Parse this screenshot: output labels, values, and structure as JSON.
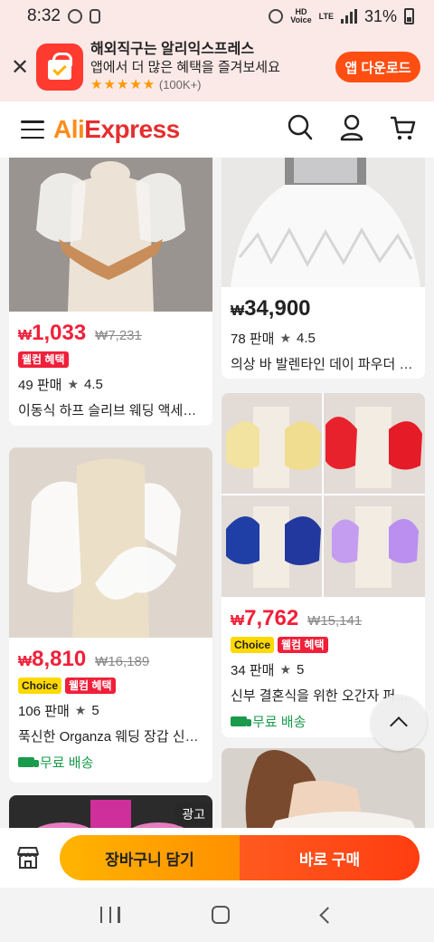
{
  "status_bar": {
    "time": "8:32",
    "network": "LTE",
    "battery": "31%"
  },
  "app_banner": {
    "title": "해외직구는 알리익스프레스",
    "subtitle": "앱에서 더 많은 혜택을 즐겨보세요",
    "stars": "★★★★★",
    "rating_count": "(100K+)",
    "download_label": "앱 다운로드"
  },
  "header": {
    "logo_prefix": "Ali",
    "logo_suffix": "Express"
  },
  "products": [
    {
      "price_symbol": "₩",
      "price": "1,033",
      "original_price": "₩7,231",
      "badges": [
        "웰컴 혜택"
      ],
      "sold": "49 판매",
      "rating": "4.5",
      "title": "이동식 하프 슬리브 웨딩 액세서리"
    },
    {
      "price_symbol": "₩",
      "price": "34,900",
      "sold": "78 판매",
      "rating": "4.5",
      "title": "의상 바 발렌타인 데이 파우더 퍼 스커트"
    },
    {
      "price_symbol": "₩",
      "price": "8,810",
      "original_price": "₩16,189",
      "badge_choice": "Choice",
      "badge_welcome": "웰컴 혜택",
      "sold": "106 판매",
      "rating": "5",
      "title": "푹신한 Organza 웨딩 장갑 신부 소매",
      "shipping": "무료 배송"
    },
    {
      "price_symbol": "₩",
      "price": "7,762",
      "original_price": "₩15,141",
      "badge_choice": "Choice",
      "badge_welcome": "웰컴 혜택",
      "sold": "34 판매",
      "rating": "5",
      "title": "신부 결혼식을 위한 오간자 퍼프 소매",
      "shipping": "무료 배송"
    }
  ],
  "ad_label": "광고",
  "bottom_bar": {
    "cart_label": "장바구니 담기",
    "buy_label": "바로 구매"
  },
  "colors": {
    "brand_red": "#f0203a",
    "cta_orange": "#ff9000",
    "cta_red": "#ff3d10",
    "shipping_green": "#1a9b4b"
  }
}
